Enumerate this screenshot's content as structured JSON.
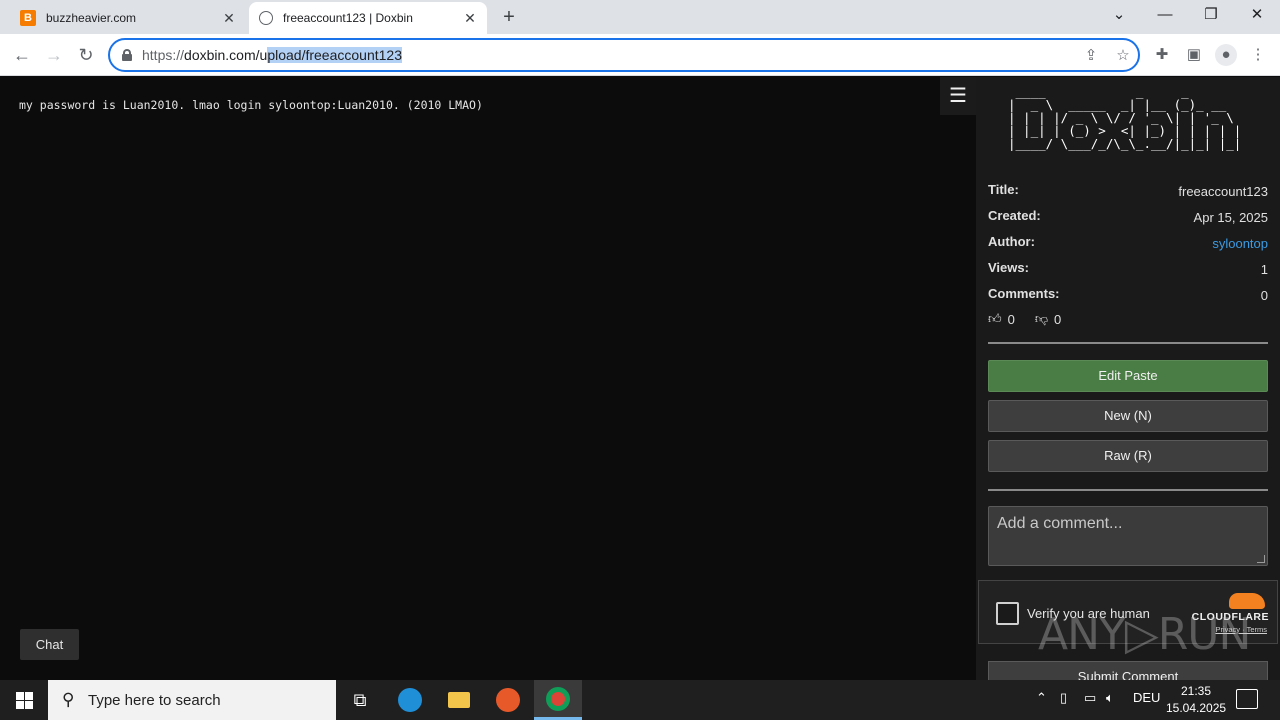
{
  "browser": {
    "tabs": [
      {
        "title": "buzzheavier.com",
        "favicon": "B",
        "active": false
      },
      {
        "title": "freeaccount123 | Doxbin",
        "favicon": "globe",
        "active": true
      }
    ],
    "url": {
      "scheme": "https://",
      "host": "doxbin.com/u",
      "selected": "pload/freeaccount123"
    }
  },
  "paste": {
    "content": "my password is Luan2010. lmao login syloontop:Luan2010. (2010 LMAO)"
  },
  "chat_label": "Chat",
  "menu_glyph": "☰",
  "sidebar": {
    "ascii_logo": " ____            _     _       \n|  _ \\  _____  _| |__ (_)_ __  \n| | | |/ _ \\ \\/ / '_ \\| | '_ \\ \n| |_| | (_) >  <| |_) | | | | |\n|____/ \\___/_/\\_\\_.__/|_|_| |_|",
    "meta": [
      {
        "key": "Title:",
        "value": "freeaccount123"
      },
      {
        "key": "Created:",
        "value": "Apr 15, 2025"
      },
      {
        "key": "Author:",
        "value": "syloontop"
      },
      {
        "key": "Views:",
        "value": "1"
      },
      {
        "key": "Comments:",
        "value": "0"
      }
    ],
    "likes": "0",
    "dislikes": "0",
    "buttons": {
      "edit": "Edit Paste",
      "new": "New (N)",
      "raw": "Raw (R)"
    },
    "comment_placeholder": "Add a comment...",
    "captcha": {
      "label": "Verify you are human",
      "brand": "CLOUDFLARE",
      "links": "Privacy · Terms"
    },
    "submit": "Submit Comment"
  },
  "watermark": "ANY▷RUN",
  "taskbar": {
    "search_placeholder": "Type here to search",
    "language": "DEU",
    "time": "21:35",
    "date": "15.04.2025"
  },
  "colors": {
    "edit_button": "#4a7c45",
    "link": "#3b9be3",
    "cloudflare": "#f48120"
  }
}
